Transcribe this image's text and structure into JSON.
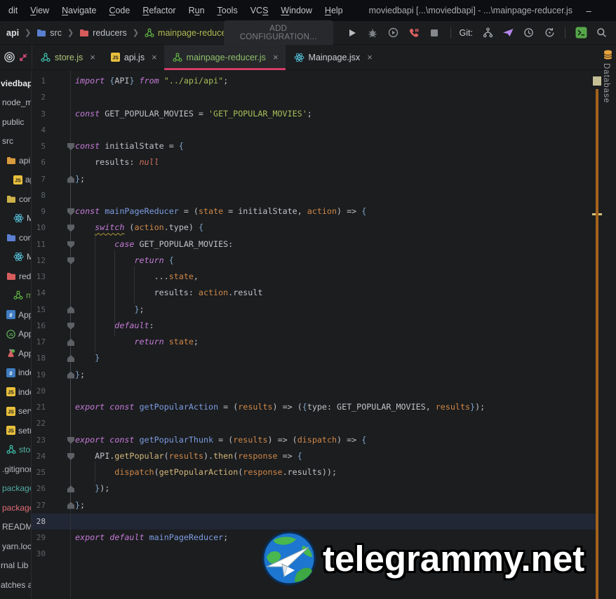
{
  "window": {
    "title": "moviedbapi [...\\moviedbapi] - ...\\mainpage-reducer.js",
    "minimize": "–",
    "maximize": "❒",
    "close": "✕"
  },
  "menu": {
    "items": [
      {
        "label": "dit",
        "u": -1
      },
      {
        "label": "View",
        "u": 0
      },
      {
        "label": "Navigate",
        "u": 0
      },
      {
        "label": "Code",
        "u": 0
      },
      {
        "label": "Refactor",
        "u": 0
      },
      {
        "label": "Run",
        "u": 1
      },
      {
        "label": "Tools",
        "u": 0
      },
      {
        "label": "VCS",
        "u": 2
      },
      {
        "label": "Window",
        "u": 0
      },
      {
        "label": "Help",
        "u": 0
      }
    ]
  },
  "navbar": {
    "breadcrumbs": [
      {
        "label": "api",
        "icon": "none",
        "color": "#dfe1e5",
        "bold": true
      },
      {
        "label": "src",
        "icon": "folder-blue",
        "color": "#bcc0c4"
      },
      {
        "label": "reducers",
        "icon": "folder-red",
        "color": "#bcc0c4"
      },
      {
        "label": "mainpage-reducer.js",
        "icon": "reducer-green",
        "color": "#b0b84f"
      }
    ],
    "add_config_label": "ADD CONFIGURATION...",
    "git_label": "Git:"
  },
  "tabs": {
    "items": [
      {
        "label": "store.js",
        "icon": "reducer-teal",
        "color": "#b3c577",
        "active": false
      },
      {
        "label": "api.js",
        "icon": "js",
        "color": "#ced0d6",
        "active": false
      },
      {
        "label": "mainpage-reducer.js",
        "icon": "reducer-green",
        "color": "#8fbf6b",
        "active": true
      },
      {
        "label": "Mainpage.jsx",
        "icon": "react",
        "color": "#ced0d6",
        "active": false
      }
    ],
    "close_glyph": "×"
  },
  "sidebar": {
    "items": [
      {
        "label": "viedbap",
        "icon": "none",
        "indent": 0,
        "bold": true,
        "color": "#e8e9eb"
      },
      {
        "label": "node_m",
        "icon": "none",
        "indent": 1,
        "color": "#bcbec4"
      },
      {
        "label": "public",
        "icon": "none",
        "indent": 1,
        "color": "#bcbec4"
      },
      {
        "label": "src",
        "icon": "none",
        "indent": 1,
        "color": "#bcbec4"
      },
      {
        "label": "api",
        "icon": "folder-orange",
        "indent": 2,
        "color": "#bcbec4"
      },
      {
        "label": "ap",
        "icon": "js",
        "indent": 3,
        "color": "#bcbec4"
      },
      {
        "label": "comp",
        "icon": "folder-yellow",
        "indent": 2,
        "color": "#bcbec4"
      },
      {
        "label": "M",
        "icon": "react",
        "indent": 3,
        "color": "#bcbec4"
      },
      {
        "label": "conta",
        "icon": "folder-blue",
        "indent": 2,
        "color": "#bcbec4"
      },
      {
        "label": "M",
        "icon": "react",
        "indent": 3,
        "color": "#bcbec4"
      },
      {
        "label": "reduc",
        "icon": "folder-red",
        "indent": 2,
        "color": "#bcbec4"
      },
      {
        "label": "m",
        "icon": "reducer-green",
        "indent": 3,
        "color": "#73a64e"
      },
      {
        "label": "App.c",
        "icon": "css",
        "indent": 2,
        "color": "#bcbec4"
      },
      {
        "label": "App.j",
        "icon": "js-green",
        "indent": 2,
        "color": "#bcbec4"
      },
      {
        "label": "App.t",
        "icon": "test",
        "indent": 2,
        "color": "#bcbec4"
      },
      {
        "label": "index",
        "icon": "css",
        "indent": 2,
        "color": "#bcbec4"
      },
      {
        "label": "index",
        "icon": "js",
        "indent": 2,
        "color": "#bcbec4"
      },
      {
        "label": "servic",
        "icon": "js",
        "indent": 2,
        "color": "#bcbec4"
      },
      {
        "label": "setup",
        "icon": "js",
        "indent": 2,
        "color": "#bcbec4"
      },
      {
        "label": "store.",
        "icon": "reducer-teal",
        "indent": 2,
        "color": "#56b6a8"
      },
      {
        "label": ".gitignor",
        "icon": "none",
        "indent": 1,
        "color": "#b4b6ba"
      },
      {
        "label": "package",
        "icon": "none",
        "indent": 1,
        "color": "#53a8a0"
      },
      {
        "label": "package",
        "icon": "none",
        "indent": 1,
        "color": "#e06c75"
      },
      {
        "label": "README",
        "icon": "none",
        "indent": 1,
        "color": "#bcbec4"
      },
      {
        "label": "yarn.lock",
        "icon": "none",
        "indent": 1,
        "color": "#bcbec4"
      },
      {
        "label": "rnal Lib",
        "icon": "none",
        "indent": 0,
        "color": "#bcbec4"
      },
      {
        "label": "atches a",
        "icon": "none",
        "indent": 0,
        "color": "#bcbec4"
      }
    ]
  },
  "editor": {
    "total_lines": 30,
    "caret_line": 28,
    "folds_open": [
      5,
      9,
      10,
      11,
      12,
      16,
      23,
      24
    ],
    "folds_close": [
      7,
      15,
      17,
      18,
      19,
      26,
      27
    ],
    "fold_line_span": [
      5,
      27
    ],
    "guides": [
      [
        90,
        10,
        18
      ],
      [
        118,
        11,
        17
      ],
      [
        146,
        12,
        15
      ],
      [
        90,
        24,
        26
      ]
    ],
    "code": [
      {
        "n": 1,
        "t": [
          [
            "k",
            "import"
          ],
          [
            "p",
            " "
          ],
          [
            "b",
            "{"
          ],
          [
            "p",
            "API"
          ],
          [
            "b",
            "}"
          ],
          [
            "p",
            " "
          ],
          [
            "k",
            "from"
          ],
          [
            "p",
            " "
          ],
          [
            "s",
            "\"../api/api\""
          ],
          [
            "p",
            ";"
          ]
        ]
      },
      {
        "n": 3,
        "t": [
          [
            "k",
            "const"
          ],
          [
            "p",
            " GET_POPULAR_MOVIES = "
          ],
          [
            "s",
            "'GET_POPULAR_MOVIES'"
          ],
          [
            "p",
            ";"
          ]
        ]
      },
      {
        "n": 5,
        "t": [
          [
            "k",
            "const"
          ],
          [
            "p",
            " initialState = "
          ],
          [
            "b",
            "{"
          ]
        ]
      },
      {
        "n": 6,
        "t": [
          [
            "p",
            "    results: "
          ],
          [
            "n",
            "null"
          ]
        ]
      },
      {
        "n": 7,
        "t": [
          [
            "b",
            "}"
          ],
          [
            "p",
            ";"
          ]
        ]
      },
      {
        "n": 9,
        "t": [
          [
            "k",
            "const"
          ],
          [
            "p",
            " "
          ],
          [
            "f",
            "mainPageReducer"
          ],
          [
            "p",
            " = ("
          ],
          [
            "a",
            "state"
          ],
          [
            "p",
            " = initialState, "
          ],
          [
            "a",
            "action"
          ],
          [
            "p",
            ") => "
          ],
          [
            "b",
            "{"
          ]
        ]
      },
      {
        "n": 10,
        "t": [
          [
            "p",
            "    "
          ],
          [
            "w",
            "switch"
          ],
          [
            "p",
            " ("
          ],
          [
            "a",
            "action"
          ],
          [
            "p",
            ".type) "
          ],
          [
            "b",
            "{"
          ]
        ]
      },
      {
        "n": 11,
        "t": [
          [
            "p",
            "        "
          ],
          [
            "k",
            "case"
          ],
          [
            "p",
            " GET_POPULAR_MOVIES:"
          ]
        ]
      },
      {
        "n": 12,
        "t": [
          [
            "p",
            "            "
          ],
          [
            "k",
            "return"
          ],
          [
            "p",
            " "
          ],
          [
            "b",
            "{"
          ]
        ]
      },
      {
        "n": 13,
        "t": [
          [
            "p",
            "                ..."
          ],
          [
            "a",
            "state"
          ],
          [
            "p",
            ","
          ]
        ]
      },
      {
        "n": 14,
        "t": [
          [
            "p",
            "                results: "
          ],
          [
            "a",
            "action"
          ],
          [
            "p",
            ".result"
          ]
        ]
      },
      {
        "n": 15,
        "t": [
          [
            "p",
            "            "
          ],
          [
            "b",
            "}"
          ],
          [
            "p",
            ";"
          ]
        ]
      },
      {
        "n": 16,
        "t": [
          [
            "p",
            "        "
          ],
          [
            "k",
            "default"
          ],
          [
            "p",
            ":"
          ]
        ]
      },
      {
        "n": 17,
        "t": [
          [
            "p",
            "            "
          ],
          [
            "k",
            "return"
          ],
          [
            "p",
            " "
          ],
          [
            "a",
            "state"
          ],
          [
            "p",
            ";"
          ]
        ]
      },
      {
        "n": 18,
        "t": [
          [
            "p",
            "    "
          ],
          [
            "b",
            "}"
          ]
        ]
      },
      {
        "n": 19,
        "t": [
          [
            "b",
            "}"
          ],
          [
            "p",
            ";"
          ]
        ]
      },
      {
        "n": 21,
        "t": [
          [
            "k",
            "export"
          ],
          [
            "p",
            " "
          ],
          [
            "k",
            "const"
          ],
          [
            "p",
            " "
          ],
          [
            "f",
            "getPopularAction"
          ],
          [
            "p",
            " = ("
          ],
          [
            "a",
            "results"
          ],
          [
            "p",
            ") => ("
          ],
          [
            "b",
            "{"
          ],
          [
            "p",
            "type: GET_POPULAR_MOVIES, "
          ],
          [
            "a",
            "results"
          ],
          [
            "b",
            "}"
          ],
          [
            "p",
            ");"
          ]
        ]
      },
      {
        "n": 23,
        "t": [
          [
            "k",
            "export"
          ],
          [
            "p",
            " "
          ],
          [
            "k",
            "const"
          ],
          [
            "p",
            " "
          ],
          [
            "f",
            "getPopularThunk"
          ],
          [
            "p",
            " = ("
          ],
          [
            "a",
            "results"
          ],
          [
            "p",
            ") => ("
          ],
          [
            "a",
            "dispatch"
          ],
          [
            "p",
            ") => "
          ],
          [
            "b",
            "{"
          ]
        ]
      },
      {
        "n": 24,
        "t": [
          [
            "p",
            "    API."
          ],
          [
            "c",
            "getPopular"
          ],
          [
            "p",
            "("
          ],
          [
            "a",
            "results"
          ],
          [
            "p",
            ")."
          ],
          [
            "c",
            "then"
          ],
          [
            "p",
            "("
          ],
          [
            "a",
            "response"
          ],
          [
            "p",
            " => "
          ],
          [
            "b",
            "{"
          ]
        ]
      },
      {
        "n": 25,
        "t": [
          [
            "p",
            "        "
          ],
          [
            "a",
            "dispatch"
          ],
          [
            "p",
            "("
          ],
          [
            "c",
            "getPopularAction"
          ],
          [
            "p",
            "("
          ],
          [
            "a",
            "response"
          ],
          [
            "p",
            ".results));"
          ]
        ]
      },
      {
        "n": 26,
        "t": [
          [
            "p",
            "    "
          ],
          [
            "b",
            "}"
          ],
          [
            "p",
            ");"
          ]
        ]
      },
      {
        "n": 27,
        "t": [
          [
            "b",
            "}"
          ],
          [
            "p",
            ";"
          ]
        ]
      },
      {
        "n": 29,
        "t": [
          [
            "k",
            "export"
          ],
          [
            "p",
            " "
          ],
          [
            "k",
            "default"
          ],
          [
            "p",
            " "
          ],
          [
            "f",
            "mainPageReducer"
          ],
          [
            "p",
            ";"
          ]
        ]
      }
    ]
  },
  "right_rail": {
    "database_label": "Database"
  },
  "watermark": {
    "text": "telegrammy.net"
  },
  "colors": {
    "accent_pink": "#d33b66",
    "vcs_added_green": "#73a64e",
    "vcs_teal": "#56b6a8",
    "vcs_red": "#e06c75",
    "stripe_orange": "#a3621b",
    "editor_bg": "#1b1d1f",
    "titlebar_bg": "#0d0e11"
  }
}
